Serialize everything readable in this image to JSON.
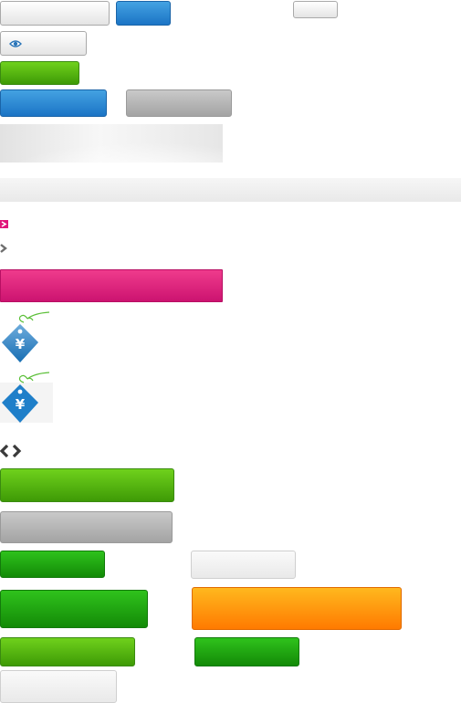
{
  "window": {
    "title": ""
  },
  "sprite": {
    "row1": {
      "input_value": "",
      "blue_button_label": "",
      "small_button_label": ""
    },
    "view_button_label": "",
    "green_button_label": "",
    "blue_wide_button_label": "",
    "gray_wide_button_label": "",
    "banner_text": "",
    "bar_text": "",
    "pink_bar_label": "",
    "icons": [
      "play-arrow-pink-icon",
      "arrow-right-gray-icon",
      "yuan-price-tag-icon",
      "yuan-price-tag-icon",
      "arrow-left-right-icon"
    ],
    "buttons_bottom": [
      {
        "label": "",
        "style": "green"
      },
      {
        "label": "",
        "style": "gray"
      },
      {
        "label": "",
        "style": "green-dark"
      },
      {
        "label": "",
        "style": "light"
      },
      {
        "label": "",
        "style": "green-dark"
      },
      {
        "label": "",
        "style": "orange"
      },
      {
        "label": "",
        "style": "green"
      },
      {
        "label": "",
        "style": "green-dark"
      },
      {
        "label": "",
        "style": "light"
      }
    ]
  },
  "colors": {
    "blue": "#1b74c5",
    "green": "#3e9a06",
    "pink": "#cc1370",
    "orange": "#ff7a00",
    "gray": "#a3a3a3",
    "tag_blue": "#1f7fc9",
    "string_green": "#5bbf38"
  }
}
